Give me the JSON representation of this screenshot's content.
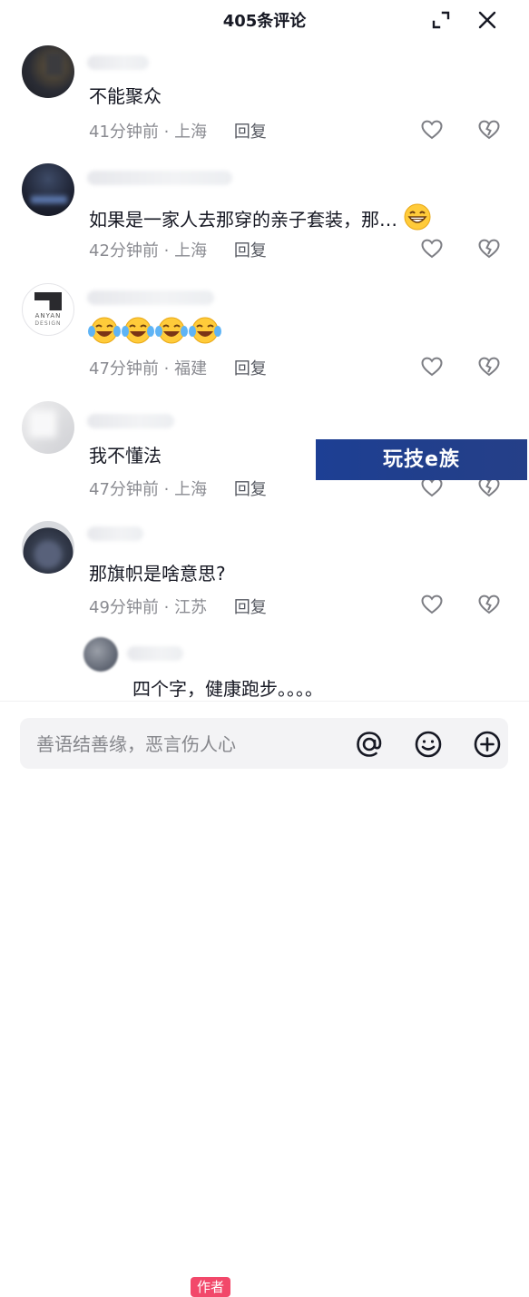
{
  "header": {
    "title": "405条评论"
  },
  "comments": [
    {
      "text": "不能聚众",
      "time": "41分钟前",
      "location": "上海",
      "reply": "回复"
    },
    {
      "text": "如果是一家人去那穿的亲子套装，那…",
      "time": "42分钟前",
      "location": "上海",
      "reply": "回复"
    },
    {
      "text": "",
      "time": "47分钟前",
      "location": "福建",
      "reply": "回复"
    },
    {
      "text": "我不懂法",
      "time": "47分钟前",
      "location": "上海",
      "reply": "回复"
    },
    {
      "text": "那旗帜是啥意思?",
      "time": "49分钟前",
      "location": "江苏",
      "reply": "回复"
    }
  ],
  "avatar_logo": {
    "line1": "ANYAN",
    "line2": "DESIGN"
  },
  "reply_preview": {
    "badge": "作者",
    "text": "四个字，健康跑步。。。。"
  },
  "watermark": {
    "text": "玩技e族"
  },
  "footer": {
    "placeholder": "善语结善缘，恶言伤人心"
  },
  "icons": {
    "header": [
      "expand-icon",
      "close-icon"
    ],
    "actions": [
      "heart-icon",
      "dislike-icon"
    ],
    "footer": [
      "at-icon",
      "emoji-icon",
      "add-icon"
    ],
    "emojis": [
      "laughing-crying-emoji",
      "grin-emoji"
    ]
  },
  "colors": {
    "text": "#161823",
    "meta": "#8a8b91",
    "badge": "#f2486a",
    "banner": "#213f8c"
  }
}
